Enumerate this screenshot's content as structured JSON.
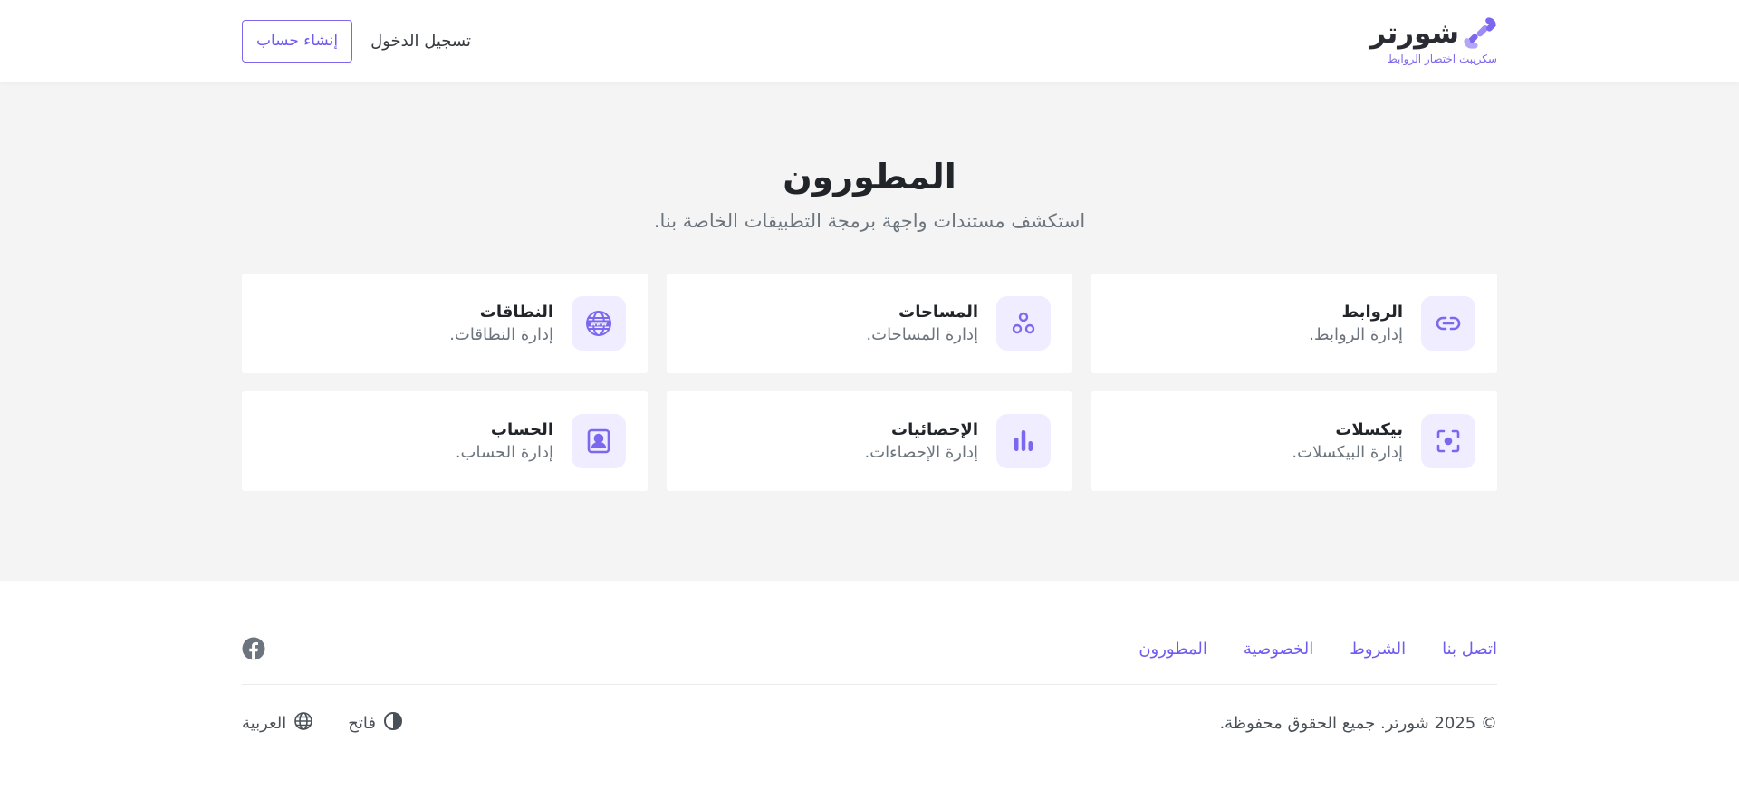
{
  "header": {
    "brand_name": "شورتر",
    "brand_tagline": "سكريبت اختصار الروابط",
    "login_label": "تسجيل الدخول",
    "signup_label": "إنشاء حساب"
  },
  "main": {
    "title": "المطورون",
    "subtitle": "استكشف مستندات واجهة برمجة التطبيقات الخاصة بنا.",
    "cards": [
      {
        "title": "الروابط",
        "desc": "إدارة الروابط.",
        "icon": "link-icon"
      },
      {
        "title": "المساحات",
        "desc": "إدارة المساحات.",
        "icon": "spaces-icon"
      },
      {
        "title": "النطاقات",
        "desc": "إدارة النطاقات.",
        "icon": "www-icon"
      },
      {
        "title": "بيكسلات",
        "desc": "إدارة البيكسلات.",
        "icon": "focus-icon"
      },
      {
        "title": "الإحصائيات",
        "desc": "إدارة الإحصاءات.",
        "icon": "bar-chart-icon"
      },
      {
        "title": "الحساب",
        "desc": "إدارة الحساب.",
        "icon": "account-icon"
      }
    ]
  },
  "footer": {
    "links": [
      "اتصل بنا",
      "الشروط",
      "الخصوصية",
      "المطورون"
    ],
    "copyright": "© 2025 شورتر. جميع الحقوق محفوظة.",
    "theme_label": "فاتح",
    "language_label": "العربية",
    "social_icon": "facebook-icon"
  },
  "colors": {
    "accent": "#7b68ee",
    "icon_bg": "#efedff",
    "main_bg": "#f4f4f4"
  }
}
